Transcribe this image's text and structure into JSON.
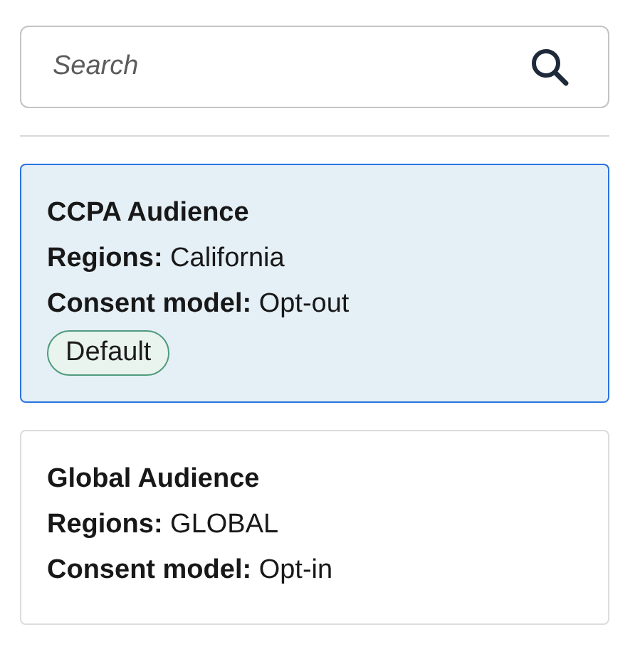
{
  "search": {
    "placeholder": "Search"
  },
  "audiences": [
    {
      "name": "CCPA Audience",
      "regions": "**Regions:** California",
      "consent": "**Consent model:** Opt-out",
      "badge": "Default",
      "selected": true
    },
    {
      "name": "Global Audience",
      "regions": "**Regions:** GLOBAL",
      "consent": "**Consent model:** Opt-in",
      "selected": false
    }
  ]
}
